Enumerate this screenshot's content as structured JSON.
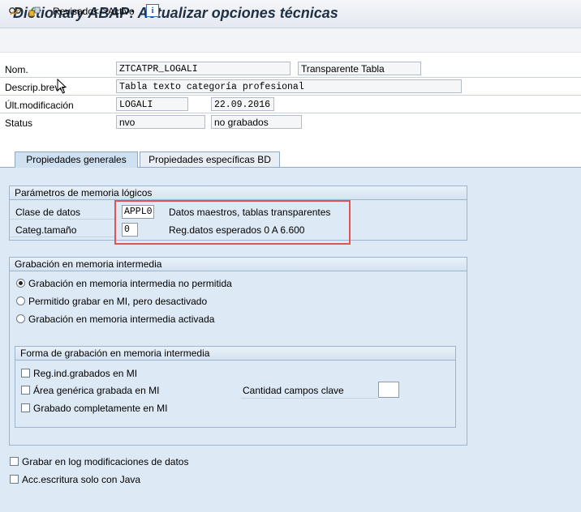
{
  "window": {
    "title": "Dictionary ABAP: Actualizar opciones técnicas"
  },
  "toolbar": {
    "icons": [
      "glasses-display-icon",
      "activate-object-icon"
    ],
    "toggle_label": "Revisado<->Activo",
    "info_icon": "i"
  },
  "header": {
    "name_label": "Nom.",
    "name_value": "ZTCATPR_LOGALI",
    "table_type": "Transparente Tabla",
    "desc_label": "Descrip.breve",
    "desc_value": "Tabla texto categoría profesional",
    "lastmod_label": "Últ.modificación",
    "lastmod_user": "LOGALI",
    "lastmod_date": "22.09.2016",
    "status_label": "Status",
    "status_value": "nvo",
    "status_text": "no grabados"
  },
  "tabs": [
    {
      "label": "Propiedades generales",
      "active": true
    },
    {
      "label": "Propiedades específicas BD",
      "active": false
    }
  ],
  "memory_params": {
    "title": "Parámetros de memoria lógicos",
    "data_class_label": "Clase de datos",
    "data_class_value": "APPL0",
    "data_class_desc": "Datos maestros, tablas transparentes",
    "size_cat_label": "Categ.tamaño",
    "size_cat_value": "0",
    "size_cat_desc": "Reg.datos esperados 0 A 6.600"
  },
  "buffering": {
    "title": "Grabación en memoria intermedia",
    "options": [
      {
        "label": "Grabación en memoria intermedia no permitida",
        "selected": true
      },
      {
        "label": "Permitido grabar en MI, pero desactivado",
        "selected": false
      },
      {
        "label": "Grabación en memoria intermedia activada",
        "selected": false
      }
    ],
    "type_group": {
      "title": "Forma de grabación en memoria intermedia",
      "options": [
        {
          "label": "Reg.ind.grabados en MI",
          "checked": false
        },
        {
          "label": "Área genérica grabada en MI",
          "checked": false
        },
        {
          "label": "Grabado completamente en MI",
          "checked": false
        }
      ],
      "key_fields_label": "Cantidad campos clave",
      "key_fields_value": ""
    }
  },
  "bottom_options": [
    {
      "label": "Grabar en log modificaciones de datos",
      "checked": false
    },
    {
      "label": "Acc.escritura solo con Java",
      "checked": false
    }
  ],
  "colors": {
    "highlight": "#e05454",
    "tab_active": "#cfe0f1",
    "panel": "#dde9f5"
  }
}
